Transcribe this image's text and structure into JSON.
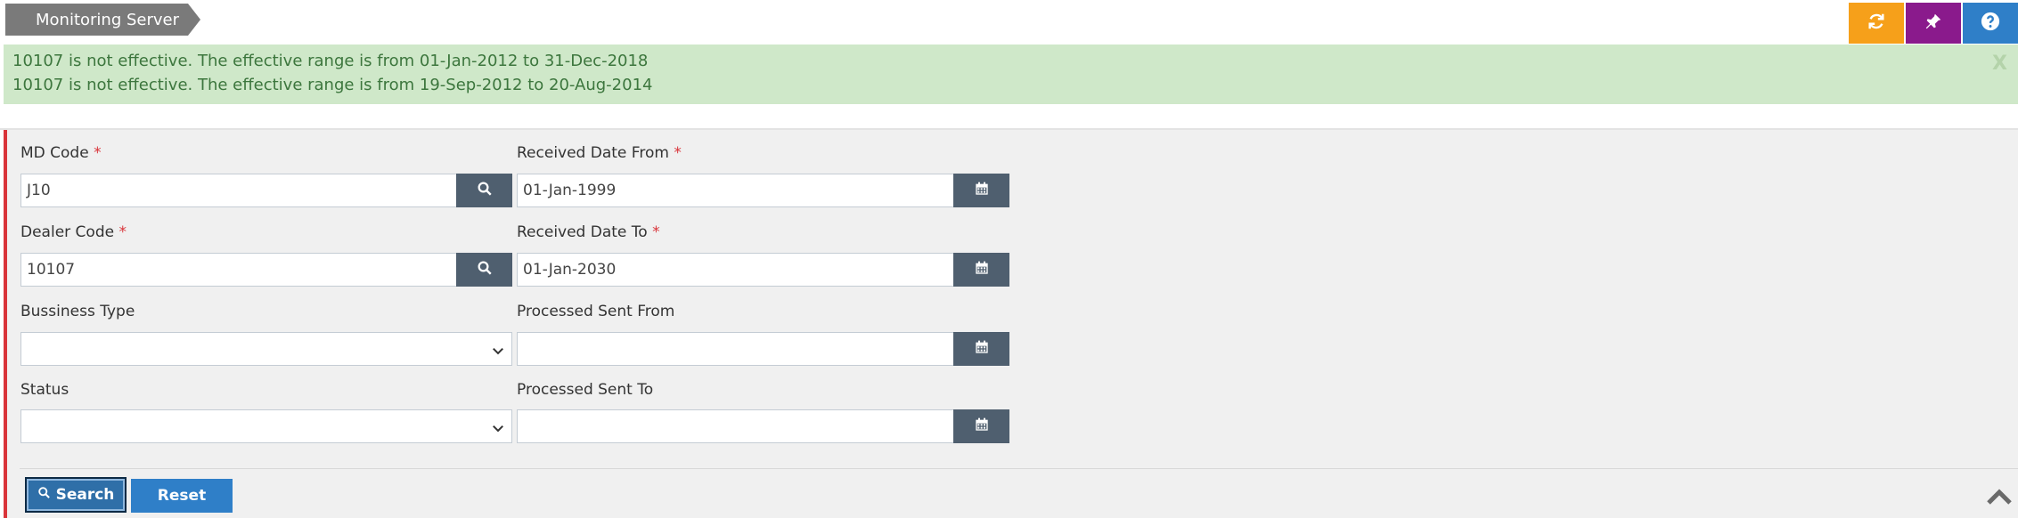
{
  "breadcrumb": {
    "title": "Monitoring Server"
  },
  "toolbar": {
    "refresh_icon": "refresh-icon",
    "pin_icon": "pin-icon",
    "help_icon": "help-icon",
    "colors": {
      "refresh": "#f6a01a",
      "pin": "#8a1a8c",
      "help": "#2f7fc8"
    }
  },
  "alert": {
    "messages": [
      "10107 is not effective. The effective range is from 01-Jan-2012 to 31-Dec-2018",
      "10107 is not effective. The effective range is from 19-Sep-2012 to 20-Aug-2014"
    ],
    "close": "X"
  },
  "form": {
    "md_code": {
      "label": "MD Code",
      "required": "*",
      "value": "J10"
    },
    "dealer_code": {
      "label": "Dealer Code",
      "required": "*",
      "value": "10107"
    },
    "business_type": {
      "label": "Bussiness Type",
      "value": ""
    },
    "status": {
      "label": "Status",
      "value": ""
    },
    "received_date_from": {
      "label": "Received Date From",
      "required": "*",
      "value": "01-Jan-1999"
    },
    "received_date_to": {
      "label": "Received Date To",
      "required": "*",
      "value": "01-Jan-2030"
    },
    "processed_sent_from": {
      "label": "Processed Sent From",
      "value": ""
    },
    "processed_sent_to": {
      "label": "Processed Sent To",
      "value": ""
    }
  },
  "actions": {
    "search_label": "Search",
    "reset_label": "Reset"
  }
}
